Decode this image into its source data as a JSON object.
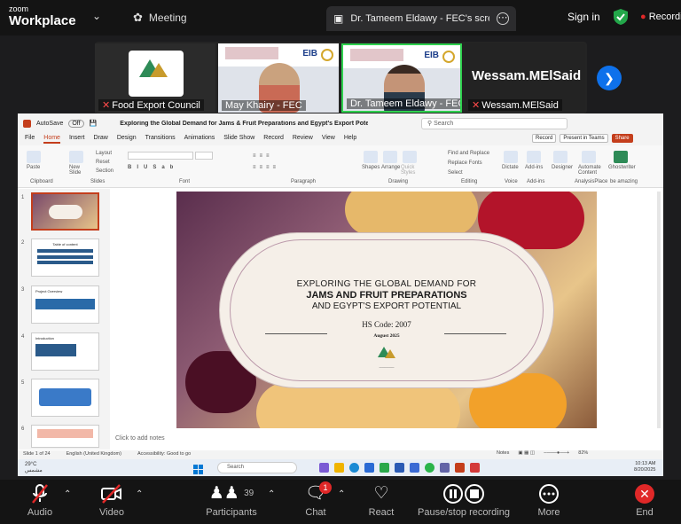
{
  "topbar": {
    "brand_small": "zoom",
    "brand": "Workplace",
    "meeting_tab": "Meeting",
    "share_tab": "Dr. Tameem Eldawy - FEC's screen",
    "sign_in": "Sign in",
    "recording": "Recording"
  },
  "participants_strip": [
    {
      "name": "Food Export Council"
    },
    {
      "name": "May Khairy - FEC"
    },
    {
      "name": "Dr. Tameem Eldawy - FEC"
    },
    {
      "name": "Wessam.MElSaid",
      "display": "Wessam.MElSaid"
    }
  ],
  "powerpoint": {
    "autosave": "AutoSave",
    "autosave_state": "Off",
    "doc_title": "Exploring the Global Demand for Jams & Fruit Preparations and Egypt's Export Potential presentati... • Saved to this PC",
    "search_placeholder": "Search",
    "menu": [
      "File",
      "Home",
      "Insert",
      "Draw",
      "Design",
      "Transitions",
      "Animations",
      "Slide Show",
      "Record",
      "Review",
      "View",
      "Help"
    ],
    "record_btn": "Record",
    "present_btn": "Present in Teams",
    "share_btn": "Share",
    "ribbon_groups": [
      "Clipboard",
      "Slides",
      "Font",
      "Paragraph",
      "Drawing",
      "Editing",
      "Voice",
      "Add-ins",
      "AnalysisPlace",
      "be amazing"
    ],
    "ribbon_items": {
      "paste": "Paste",
      "new_slide": "New Slide",
      "layout": "Layout",
      "reset": "Reset",
      "section": "Section",
      "shapes": "Shapes",
      "arrange": "Arrange",
      "quick_styles": "Quick Styles",
      "find_replace": "Find and Replace",
      "replace_fonts": "Replace Fonts",
      "select": "Select",
      "dictate": "Dictate",
      "addins": "Add-ins",
      "designer": "Designer",
      "automate": "Automate Content",
      "ghostwriter": "Ghostwriter"
    },
    "slide_thumbs": [
      "1",
      "2",
      "3",
      "4",
      "5",
      "6"
    ],
    "thumb_titles": [
      "",
      "Table of content",
      "Project Overview",
      "Introduction",
      "",
      ""
    ],
    "notes_placeholder": "Click to add notes",
    "status": {
      "slide_of": "Slide 1 of 24",
      "language": "English (United Kingdom)",
      "accessibility": "Accessibility: Good to go",
      "notes": "Notes",
      "zoom": "82%"
    }
  },
  "slide": {
    "line1": "EXPLORING THE GLOBAL DEMAND FOR",
    "line2": "JAMS AND FRUIT PREPARATIONS",
    "line3": "AND EGYPT'S EXPORT POTENTIAL",
    "hs_code": "HS Code: 2007",
    "date": "August 2025"
  },
  "taskbar": {
    "weather_temp": "29°C",
    "weather_desc": "مشمس",
    "search": "Search",
    "time": "10:13 AM",
    "date": "8/20/2025"
  },
  "bottombar": {
    "audio": "Audio",
    "video": "Video",
    "participants": "Participants",
    "participants_count": "39",
    "chat": "Chat",
    "chat_badge": "1",
    "react": "React",
    "pause_stop": "Pause/stop recording",
    "more": "More",
    "end": "End"
  },
  "colors": {
    "accent_blue": "#0e71eb",
    "active_speaker": "#2fd14f",
    "powerpoint_red": "#c43e1c",
    "end_red": "#e02828"
  }
}
